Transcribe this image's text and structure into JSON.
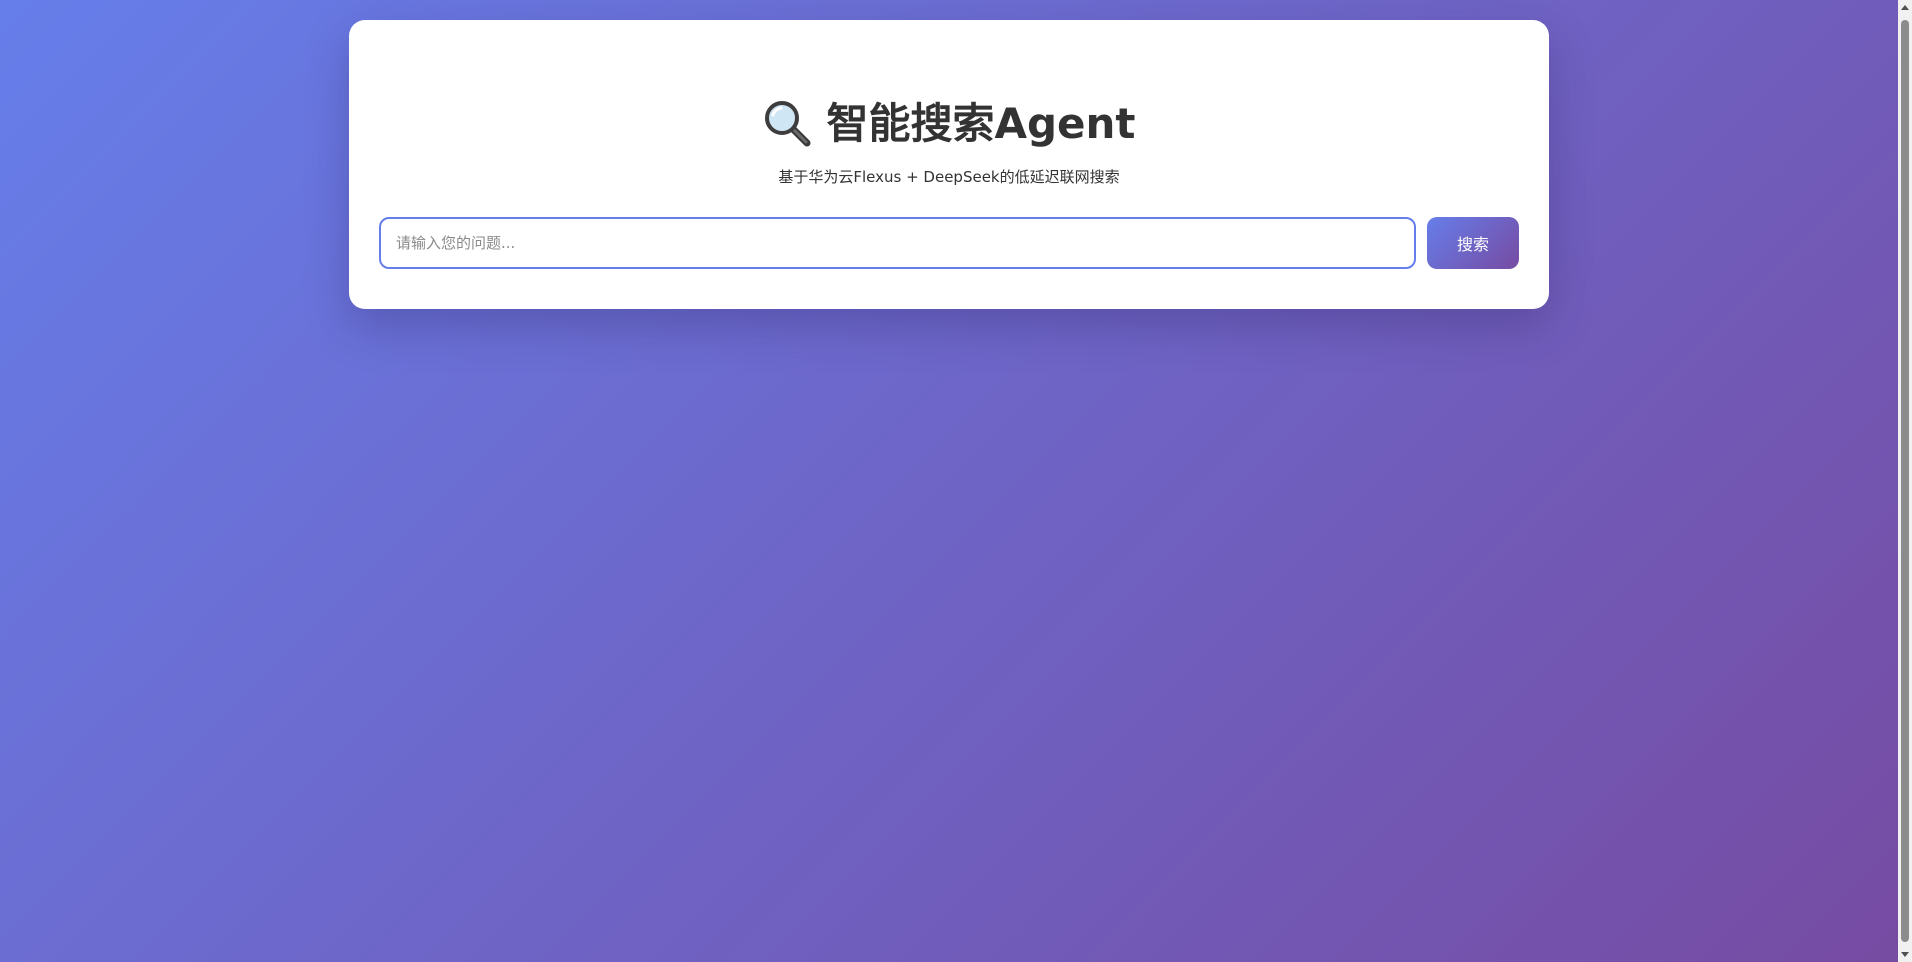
{
  "header": {
    "icon": "magnifying-glass-icon",
    "title": "智能搜索Agent",
    "subtitle": "基于华为云Flexus + DeepSeek的低延迟联网搜索"
  },
  "search": {
    "value": "",
    "placeholder": "请输入您的问题...",
    "button_label": "搜索"
  },
  "colors": {
    "gradient_start": "#667eea",
    "gradient_end": "#764ba2",
    "card_background": "#ffffff",
    "text": "#333333"
  }
}
